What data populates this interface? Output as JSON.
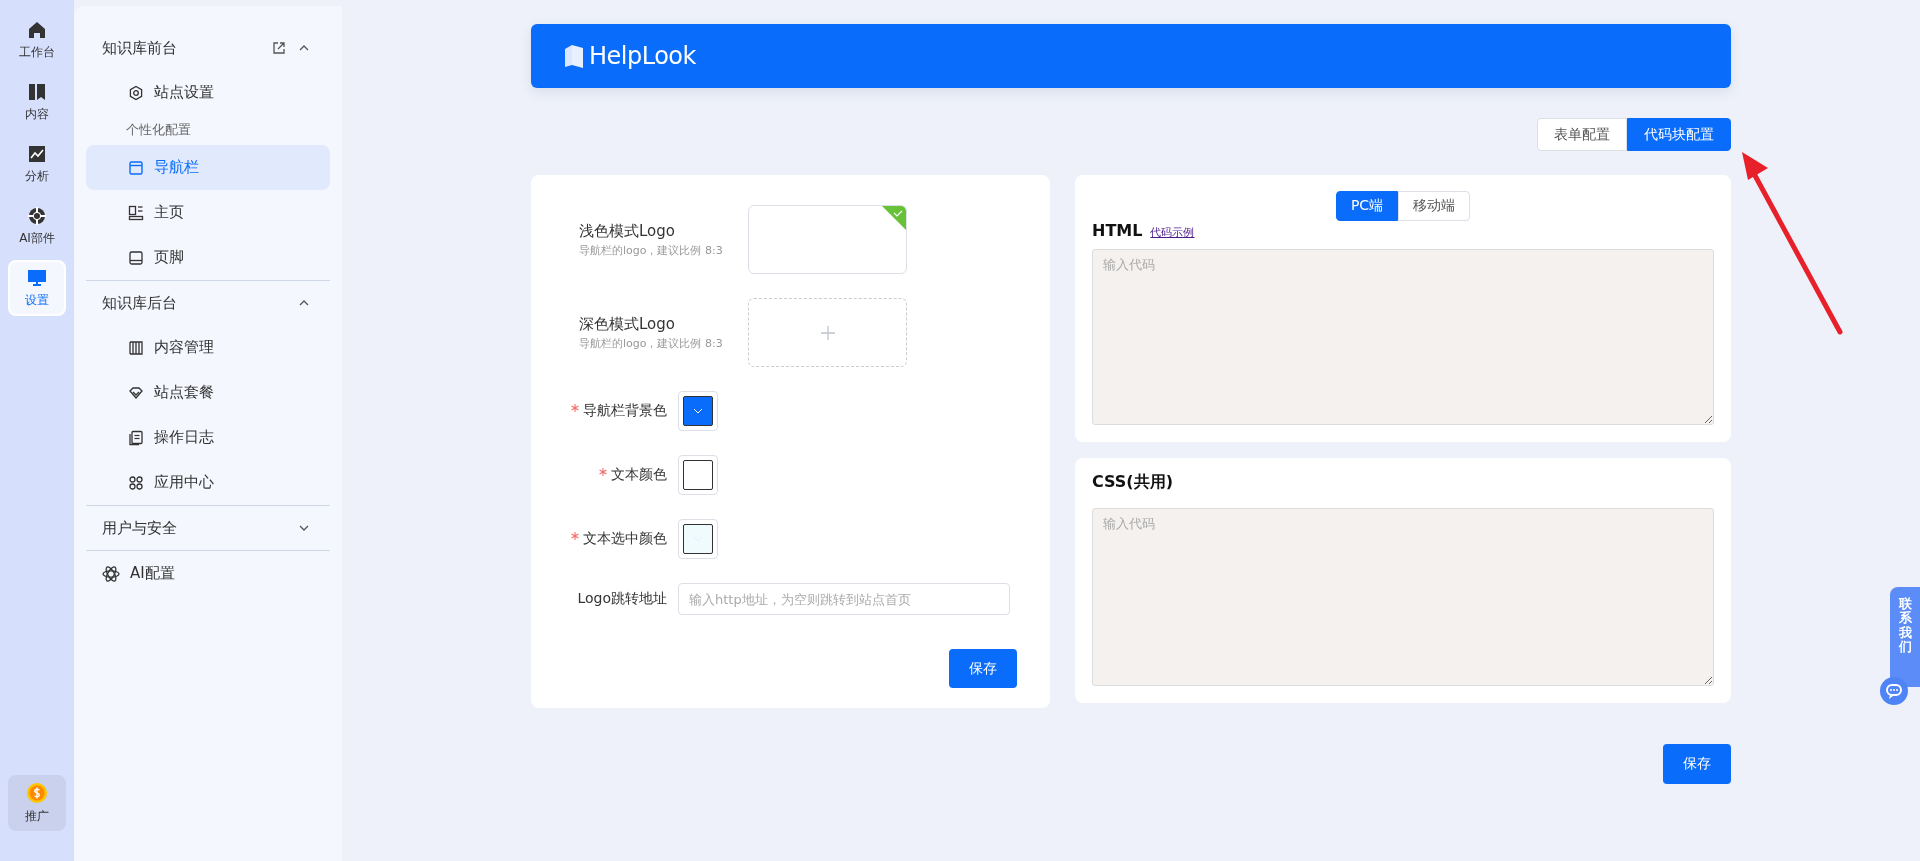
{
  "rail": {
    "items": [
      {
        "label": "工作台",
        "selected": false
      },
      {
        "label": "内容",
        "selected": false
      },
      {
        "label": "分析",
        "selected": false
      },
      {
        "label": "AI部件",
        "selected": false
      },
      {
        "label": "设置",
        "selected": true
      }
    ],
    "promo": {
      "label": "推广"
    }
  },
  "sidebar": {
    "groups": [
      {
        "title": "知识库前台",
        "expanded": true,
        "external_link": true,
        "items": [
          {
            "kind": "link",
            "label": "站点设置",
            "selected": false
          },
          {
            "kind": "subheader",
            "label": "个性化配置"
          },
          {
            "kind": "link",
            "label": "导航栏",
            "selected": true
          },
          {
            "kind": "link",
            "label": "主页",
            "selected": false
          },
          {
            "kind": "link",
            "label": "页脚",
            "selected": false
          }
        ]
      },
      {
        "title": "知识库后台",
        "expanded": true,
        "external_link": false,
        "items": [
          {
            "kind": "link",
            "label": "内容管理",
            "selected": false
          },
          {
            "kind": "link",
            "label": "站点套餐",
            "selected": false
          },
          {
            "kind": "link",
            "label": "操作日志",
            "selected": false
          },
          {
            "kind": "link",
            "label": "应用中心",
            "selected": false
          }
        ]
      },
      {
        "title": "用户与安全",
        "expanded": false,
        "external_link": false
      }
    ],
    "bottom_item": {
      "label": "AI配置"
    }
  },
  "header": {
    "logo": "HelpLook"
  },
  "mode_tabs": [
    {
      "label": "表单配置",
      "selected": false
    },
    {
      "label": "代码块配置",
      "selected": true
    }
  ],
  "form": {
    "fields": [
      {
        "kind": "upload",
        "label": "浅色模式Logo",
        "hint": "导航栏的logo，建议比例 8:3",
        "uploaded": true
      },
      {
        "kind": "upload",
        "label": "深色模式Logo",
        "hint": "导航栏的logo，建议比例 8:3",
        "uploaded": false
      },
      {
        "kind": "color",
        "label": "导航栏背景色",
        "required": true,
        "color": "#0a6cfa"
      },
      {
        "kind": "color",
        "label": "文本颜色",
        "required": true,
        "color": "#ffffff"
      },
      {
        "kind": "color",
        "label": "文本选中颜色",
        "required": true,
        "color": "#effbfd"
      },
      {
        "kind": "text",
        "label": "Logo跳转地址",
        "required": false,
        "placeholder": "输入http地址，为空则跳转到站点首页"
      }
    ],
    "save": "保存"
  },
  "code": {
    "device_tabs": [
      {
        "label": "PC端",
        "selected": true
      },
      {
        "label": "移动端",
        "selected": false
      }
    ],
    "html": {
      "title": "HTML",
      "link": "代码示例",
      "placeholder": "输入代码"
    },
    "css": {
      "title": "CSS(共用)",
      "placeholder": "输入代码"
    },
    "save": "保存"
  },
  "contact": {
    "label": "联系我们"
  }
}
